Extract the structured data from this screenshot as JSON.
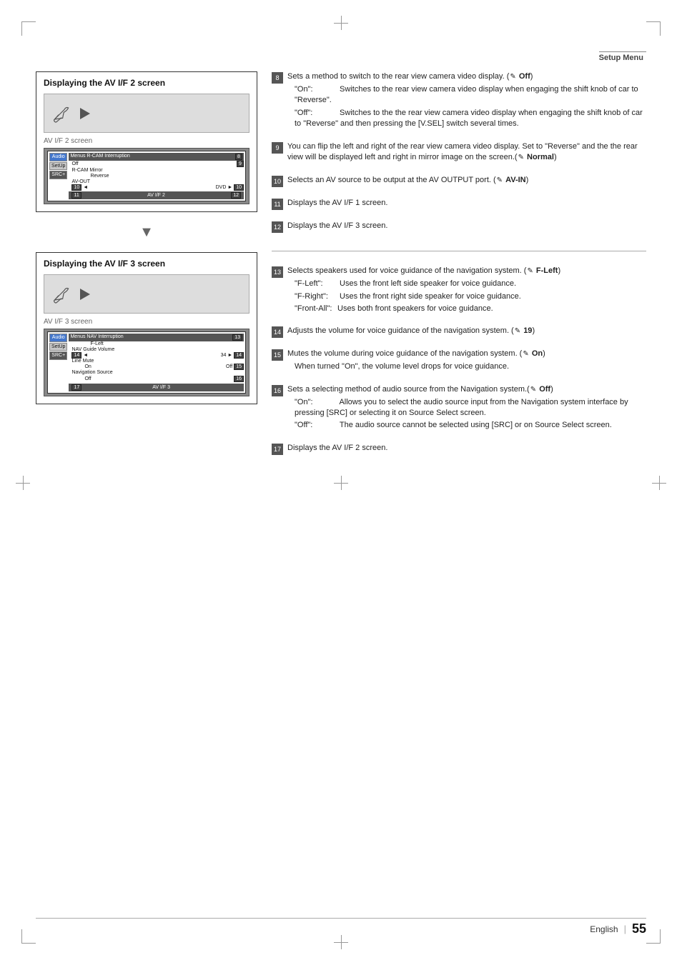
{
  "page": {
    "header_title": "Setup Menu",
    "footer_lang": "English",
    "footer_pipe": "|",
    "footer_page": "55"
  },
  "section1": {
    "title": "Displaying the AV I/F 2 screen",
    "screen_label": "AV I/F 2 screen",
    "menu_title": "Menus R-CAM Interruption",
    "menu_rows": [
      {
        "label": "Off",
        "value": ""
      },
      {
        "label": "R-CAM Mirror",
        "value": ""
      },
      {
        "label": "",
        "value": "Reverse"
      },
      {
        "label": "AV-OUT",
        "value": ""
      },
      {
        "label": "",
        "value": "DVD"
      }
    ],
    "bottom_label": "AV I/F 2",
    "badge_8": "8",
    "badge_9": "9",
    "badge_10": "10",
    "badge_11": "11",
    "badge_12": "12"
  },
  "section2": {
    "title": "Displaying the AV I/F 3 screen",
    "screen_label": "AV I/F 3 screen",
    "menu_title": "Menus NAV Interruption",
    "menu_rows": [
      {
        "label": "F-Left",
        "value": ""
      },
      {
        "label": "NAV Guide Volume",
        "value": ""
      },
      {
        "label": "34",
        "value": ""
      },
      {
        "label": "Line Mute",
        "value": ""
      },
      {
        "label": "On",
        "value": "Off"
      },
      {
        "label": "Navigation Source",
        "value": ""
      },
      {
        "label": "Off",
        "value": ""
      }
    ],
    "bottom_label": "AV I/F 3",
    "badge_13": "13",
    "badge_14": "14",
    "badge_15": "15",
    "badge_16": "16",
    "badge_17": "17"
  },
  "items": {
    "item8": {
      "num": "8",
      "text": "Sets a method to switch to the rear view camera video display. (",
      "default": "Off",
      "sub1_label": "“On”:",
      "sub1_text": "Switches to the rear view camera video display when engaging  the shift knob of car to “Reverse”.",
      "sub2_label": "“Off”:",
      "sub2_text": "Switches to the the rear view camera video display when engaging  the shift knob of car to “Reverse” and then pressing the [V.SEL] switch several times."
    },
    "item9": {
      "num": "9",
      "text": "You can flip the left and right of the rear view camera video display. Set to “Reverse” and the the rear view will be displayed left and right in mirror image on the screen. (",
      "default": "Normal"
    },
    "item10": {
      "num": "10",
      "text": "Selects an AV source to be output at the AV OUTPUT port. (",
      "default": "AV-IN"
    },
    "item11": {
      "num": "11",
      "text": "Displays the AV I/F 1 screen."
    },
    "item12": {
      "num": "12",
      "text": "Displays the AV I/F 3 screen."
    },
    "item13": {
      "num": "13",
      "text": "Selects speakers used for voice guidance of the navigation system. (",
      "default": "F-Left",
      "sub1_label": "“F-Left”:",
      "sub1_text": "Uses the front left side speaker for voice guidance.",
      "sub2_label": "“F-Right”:",
      "sub2_text": "Uses the front right side speaker for voice guidance.",
      "sub3_label": "“Front-All”:",
      "sub3_text": "Uses both front speakers for voice guidance."
    },
    "item14": {
      "num": "14",
      "text": "Adjusts the volume for voice guidance of the navigation system. (",
      "default": "19"
    },
    "item15": {
      "num": "15",
      "text": "Mutes the volume during voice guidance of the navigation system. (",
      "default": "On",
      "sub1_text": "When turned “On”, the volume level drops for voice guidance."
    },
    "item16": {
      "num": "16",
      "text": "Sets a selecting method of audio source from the Navigation system.(",
      "default": "Off",
      "sub1_label": "“On”:",
      "sub1_text": "Allows you to select the audio source input from the Navigation system interface by pressing [SRC] or selecting it on Source Select screen.",
      "sub2_label": "“Off”:",
      "sub2_text": "The audio source cannot be selected using [SRC] or on Source Select screen."
    },
    "item17": {
      "num": "17",
      "text": "Displays the AV I/F 2 screen."
    }
  }
}
